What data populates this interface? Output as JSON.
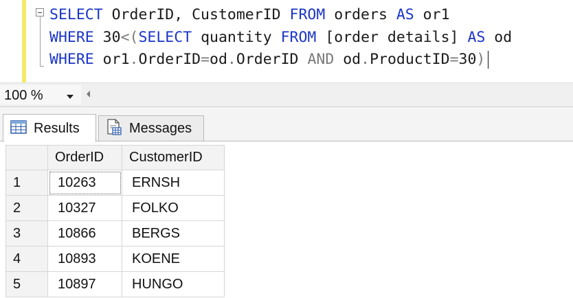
{
  "editor": {
    "line1": {
      "kw1": "SELECT",
      "id1": " OrderID, CustomerID ",
      "kw2": "FROM",
      "id2": " orders ",
      "kw3": "AS",
      "id3": " or1"
    },
    "line2": {
      "kw1": "WHERE",
      "id1": " 30",
      "gr1": "<(",
      "kw2": "SELECT",
      "id2": " quantity ",
      "kw3": "FROM",
      "id3": " [order details] ",
      "kw4": "AS",
      "id4": " od"
    },
    "line3": {
      "kw1": "WHERE",
      "id1": " or1",
      "gr1": ".",
      "id2": "OrderID",
      "gr2": "=",
      "id3": "od",
      "gr3": ".",
      "id4": "OrderID ",
      "gr4": "AND",
      "id5": " od",
      "gr5": ".",
      "id6": "ProductID",
      "gr6": "=",
      "id7": "30",
      "gr7": ")"
    }
  },
  "zoom": {
    "value": "100 %"
  },
  "tabs": {
    "results": "Results",
    "messages": "Messages"
  },
  "grid": {
    "columns": [
      "OrderID",
      "CustomerID"
    ],
    "rows": [
      {
        "n": "1",
        "order_id": "10263",
        "customer_id": "ERNSH"
      },
      {
        "n": "2",
        "order_id": "10327",
        "customer_id": "FOLKO"
      },
      {
        "n": "3",
        "order_id": "10866",
        "customer_id": "BERGS"
      },
      {
        "n": "4",
        "order_id": "10893",
        "customer_id": "KOENE"
      },
      {
        "n": "5",
        "order_id": "10897",
        "customer_id": "HUNGO"
      }
    ]
  },
  "colors": {
    "keyword": "#1a35c7",
    "operator": "#7a7a7a",
    "margin": "#f2e96a"
  },
  "icons": {
    "results_tab": "grid-table-icon",
    "messages_tab": "document-messages-icon",
    "collapse": "collapse-minus-icon",
    "zoom_dropdown": "chevron-down-icon"
  }
}
